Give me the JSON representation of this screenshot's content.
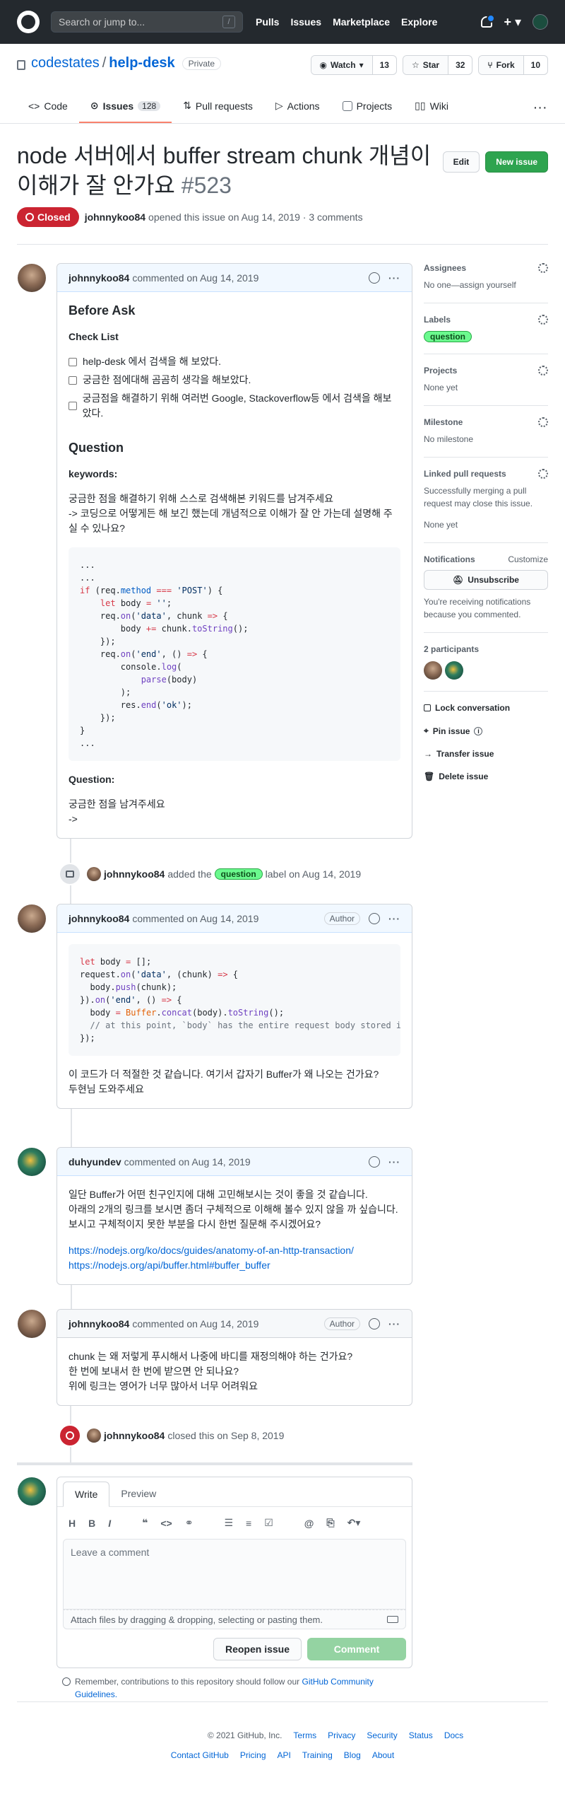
{
  "header": {
    "search_placeholder": "Search or jump to...",
    "search_key": "/",
    "nav": [
      "Pulls",
      "Issues",
      "Marketplace",
      "Explore"
    ]
  },
  "repo": {
    "owner": "codestates",
    "name": "help-desk",
    "visibility": "Private",
    "watch_label": "Watch",
    "watch_count": "13",
    "star_label": "Star",
    "star_count": "32",
    "fork_label": "Fork",
    "fork_count": "10",
    "tabs": [
      {
        "label": "Code"
      },
      {
        "label": "Issues",
        "count": "128"
      },
      {
        "label": "Pull requests"
      },
      {
        "label": "Actions"
      },
      {
        "label": "Projects"
      },
      {
        "label": "Wiki"
      }
    ]
  },
  "issue": {
    "title": "node 서버에서 buffer stream chunk 개념이 이해가 잘 안가요",
    "number": "#523",
    "edit_label": "Edit",
    "new_label": "New issue",
    "state": "Closed",
    "author": "johnnykoo84",
    "opened_text": "opened this issue on Aug 14, 2019 · 3 comments"
  },
  "comments": {
    "c1": {
      "author": "johnnykoo84",
      "meta": "commented on Aug 14, 2019",
      "h_before": "Before Ask",
      "h_checklist": "Check List",
      "checks": [
        "help-desk 에서 검색을 해 보았다.",
        "궁금한 점에대해 곰곰히 생각을 해보았다.",
        "궁금점을 해결하기 위해 여러번 Google, Stackoverflow등 에서 검색을 해보았다."
      ],
      "h_question": "Question",
      "h_keywords": "keywords:",
      "p1a": "궁금한 점을 해결하기 위해 스스로 검색해본 키워드를 남겨주세요",
      "p1b": "-> 코딩으로 어떻게든 해 보긴 했는데 개념적으로 이해가 잘 안 가는데 설명해 주실 수 있나요?",
      "h_q2": "Question:",
      "p2a": "궁금한 점을 남겨주세요",
      "p2b": "->"
    },
    "e1": {
      "actor": "johnnykoo84",
      "pre": "added the",
      "label": "question",
      "post": "label on Aug 14, 2019"
    },
    "c2": {
      "author": "johnnykoo84",
      "meta": "commented on Aug 14, 2019",
      "badge": "Author",
      "p1": "이 코드가 더 적절한 것 같습니다. 여기서 갑자기 Buffer가 왜 나오는 건가요?",
      "p2": "두현님 도와주세요"
    },
    "c3": {
      "author": "duhyundev",
      "meta": "commented on Aug 14, 2019",
      "p1": "일단 Buffer가 어떤 친구인지에 대해 고민해보시는 것이 좋을 것 같습니다.",
      "p2": "아래의 2개의 링크를 보시면 좀더 구체적으로 이해해 볼수 있지 않을 까 싶습니다.",
      "p3": "보시고 구체적이지 못한 부분을 다시 한번 질문해 주시겠어요?",
      "link1": "https://nodejs.org/ko/docs/guides/anatomy-of-an-http-transaction/",
      "link2": "https://nodejs.org/api/buffer.html#buffer_buffer"
    },
    "c4": {
      "author": "johnnykoo84",
      "meta": "commented on Aug 14, 2019",
      "badge": "Author",
      "p1": "chunk 는 왜 저렇게 푸시해서 나중에 바디를 재정의해야 하는 건가요?",
      "p2": "한 번에 보내서 한 번에 받으면 안 되나요?",
      "p3": "위에 링크는 영어가 너무 많아서 너무 어려워요"
    },
    "e2": {
      "actor": "johnnykoo84",
      "text": "closed this on Sep 8, 2019"
    }
  },
  "form": {
    "tab_write": "Write",
    "tab_preview": "Preview",
    "placeholder": "Leave a comment",
    "attach": "Attach files by dragging & dropping, selecting or pasting them.",
    "reopen": "Reopen issue",
    "comment": "Comment",
    "reminder": "Remember, contributions to this repository should follow our",
    "reminder_link": "GitHub Community Guidelines."
  },
  "sidebar": {
    "assignees_h": "Assignees",
    "assignees_v": "No one—assign yourself",
    "labels_h": "Labels",
    "label": "question",
    "projects_h": "Projects",
    "projects_v": "None yet",
    "milestone_h": "Milestone",
    "milestone_v": "No milestone",
    "linked_h": "Linked pull requests",
    "linked_v": "Successfully merging a pull request may close this issue.",
    "linked_v2": "None yet",
    "notif_h": "Notifications",
    "notif_customize": "Customize",
    "unsub": "Unsubscribe",
    "notif_v": "You're receiving notifications because you commented.",
    "participants": "2 participants",
    "lock": "Lock conversation",
    "pin": "Pin issue",
    "transfer": "Transfer issue",
    "delete": "Delete issue"
  },
  "footer": {
    "copyright": "© 2021 GitHub, Inc.",
    "row1": [
      "Terms",
      "Privacy",
      "Security",
      "Status",
      "Docs"
    ],
    "row2": [
      "Contact GitHub",
      "Pricing",
      "API",
      "Training",
      "Blog",
      "About"
    ]
  },
  "colors": {
    "accent": "#f9826c",
    "closed": "#cb2431",
    "green": "#2ea44f",
    "label": "#6bf98e"
  }
}
